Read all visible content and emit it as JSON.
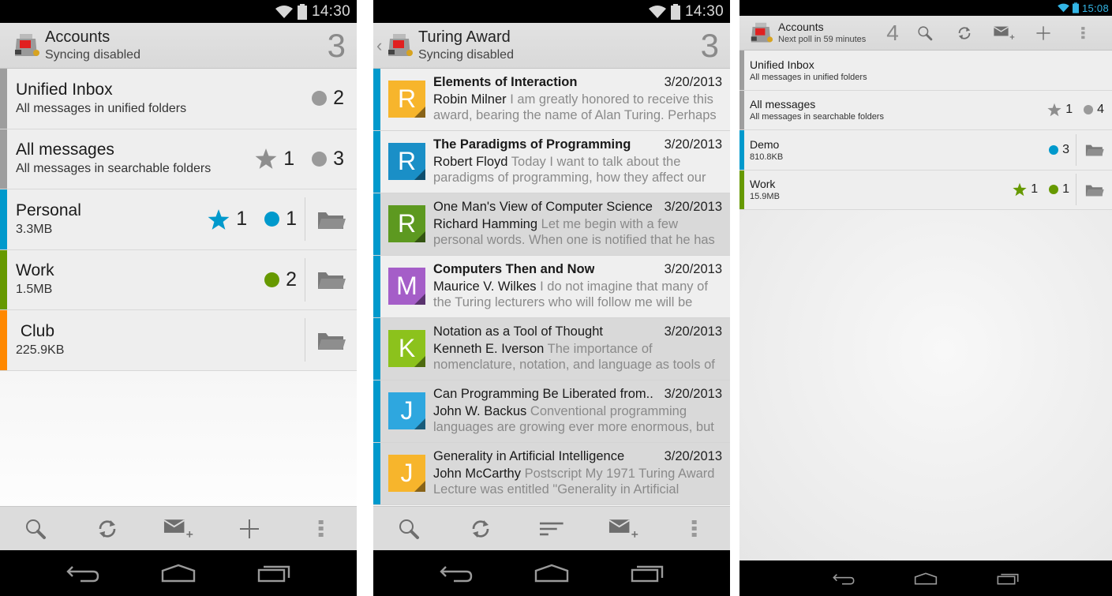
{
  "colors": {
    "gray_stripe": "#9e9e9e",
    "blue": "#0099cc",
    "green": "#669900",
    "orange": "#ff8800",
    "star_gray": "#8e8e8e",
    "dot_gray": "#9a9a9a",
    "holo_blue": "#33b5e5"
  },
  "panel1": {
    "status": {
      "time": "14:30"
    },
    "header": {
      "title": "Accounts",
      "subtitle": "Syncing disabled",
      "count": "3"
    },
    "rows": [
      {
        "name": "Unified Inbox",
        "sub": "All messages in unified folders",
        "stripe": "#9e9e9e",
        "flagged": null,
        "unread": "2",
        "unread_color": "#9a9a9a",
        "star_color": null,
        "folder": false
      },
      {
        "name": "All messages",
        "sub": "All messages in searchable folders",
        "stripe": "#9e9e9e",
        "flagged": "1",
        "unread": "3",
        "unread_color": "#9a9a9a",
        "star_color": "#8e8e8e",
        "folder": false
      },
      {
        "name": "Personal",
        "sub": "3.3MB",
        "stripe": "#0099cc",
        "flagged": "1",
        "unread": "1",
        "unread_color": "#0099cc",
        "star_color": "#0099cc",
        "folder": true
      },
      {
        "name": "Work",
        "sub": "1.5MB",
        "stripe": "#669900",
        "flagged": null,
        "unread": "2",
        "unread_color": "#669900",
        "star_color": null,
        "folder": true
      },
      {
        "name": " Club",
        "sub": "225.9KB",
        "stripe": "#ff8800",
        "flagged": null,
        "unread": null,
        "unread_color": null,
        "star_color": null,
        "folder": true
      }
    ],
    "toolbar": [
      "search-icon",
      "refresh-icon",
      "compose-icon",
      "add-icon",
      "overflow-menu-icon"
    ]
  },
  "panel2": {
    "status": {
      "time": "14:30"
    },
    "header": {
      "title": "Turing Award",
      "subtitle": "Syncing disabled",
      "count": "3"
    },
    "messages": [
      {
        "initial": "R",
        "color": "#f7b52c",
        "subject": "Elements of Interaction",
        "date": "3/20/2013",
        "sender": "Robin Milner",
        "preview": "I am greatly honored to receive this award, bearing the name of Alan Turing. Perhaps",
        "read": false
      },
      {
        "initial": "R",
        "color": "#1a8fc7",
        "subject": "The Paradigms of Programming",
        "date": "3/20/2013",
        "sender": "Robert Floyd",
        "preview": "Today I want to talk about the paradigms of programming, how they affect our",
        "read": false
      },
      {
        "initial": "R",
        "color": "#5d9920",
        "subject": "One Man's View of Computer Science",
        "date": "3/20/2013",
        "sender": "Richard Hamming",
        "preview": "Let me begin with a few personal words. When one is notified that he has",
        "read": true
      },
      {
        "initial": "M",
        "color": "#a55ec8",
        "subject": "Computers Then and Now",
        "date": "3/20/2013",
        "sender": "Maurice V. Wilkes",
        "preview": "I do not imagine that many of the Turing lecturers who will follow me will be",
        "read": false
      },
      {
        "initial": "K",
        "color": "#8cc21c",
        "subject": "Notation as a Tool of Thought",
        "date": "3/20/2013",
        "sender": "Kenneth E. Iverson",
        "preview": "The importance of nomenclature, notation, and language as tools of",
        "read": true
      },
      {
        "initial": "J",
        "color": "#2ea7df",
        "subject": "Can Programming Be Liberated from..",
        "date": "3/20/2013",
        "sender": "John W. Backus",
        "preview": "Conventional programming languages are growing ever more enormous, but",
        "read": true
      },
      {
        "initial": "J",
        "color": "#f7b52c",
        "subject": "Generality in Artificial Intelligence",
        "date": "3/20/2013",
        "sender": "John McCarthy",
        "preview": "Postscript My 1971 Turing Award Lecture was entitled \"Generality in Artificial",
        "read": true
      }
    ],
    "toolbar": [
      "search-icon",
      "refresh-icon",
      "sort-icon",
      "compose-icon",
      "overflow-menu-icon"
    ]
  },
  "panel3": {
    "status": {
      "time": "15:08"
    },
    "header": {
      "title": "Accounts",
      "subtitle": "Next poll in 59 minutes",
      "count": "4"
    },
    "actions": [
      "search-icon",
      "refresh-icon",
      "compose-icon",
      "add-icon",
      "overflow-menu-icon"
    ],
    "rows": [
      {
        "name": "Unified Inbox",
        "sub": "All messages in unified folders",
        "stripe": "#9e9e9e",
        "flagged": null,
        "unread": null,
        "unread_color": null,
        "star_color": null,
        "folder": false
      },
      {
        "name": "All messages",
        "sub": "All messages in searchable folders",
        "stripe": "#9e9e9e",
        "flagged": "1",
        "unread": "4",
        "unread_color": "#9a9a9a",
        "star_color": "#8e8e8e",
        "folder": false
      },
      {
        "name": "Demo",
        "sub": "810.8KB",
        "stripe": "#0099cc",
        "flagged": null,
        "unread": "3",
        "unread_color": "#0099cc",
        "star_color": null,
        "folder": true
      },
      {
        "name": "Work",
        "sub": "15.9MB",
        "stripe": "#669900",
        "flagged": "1",
        "unread": "1",
        "unread_color": "#669900",
        "star_color": "#669900",
        "folder": true
      }
    ]
  }
}
